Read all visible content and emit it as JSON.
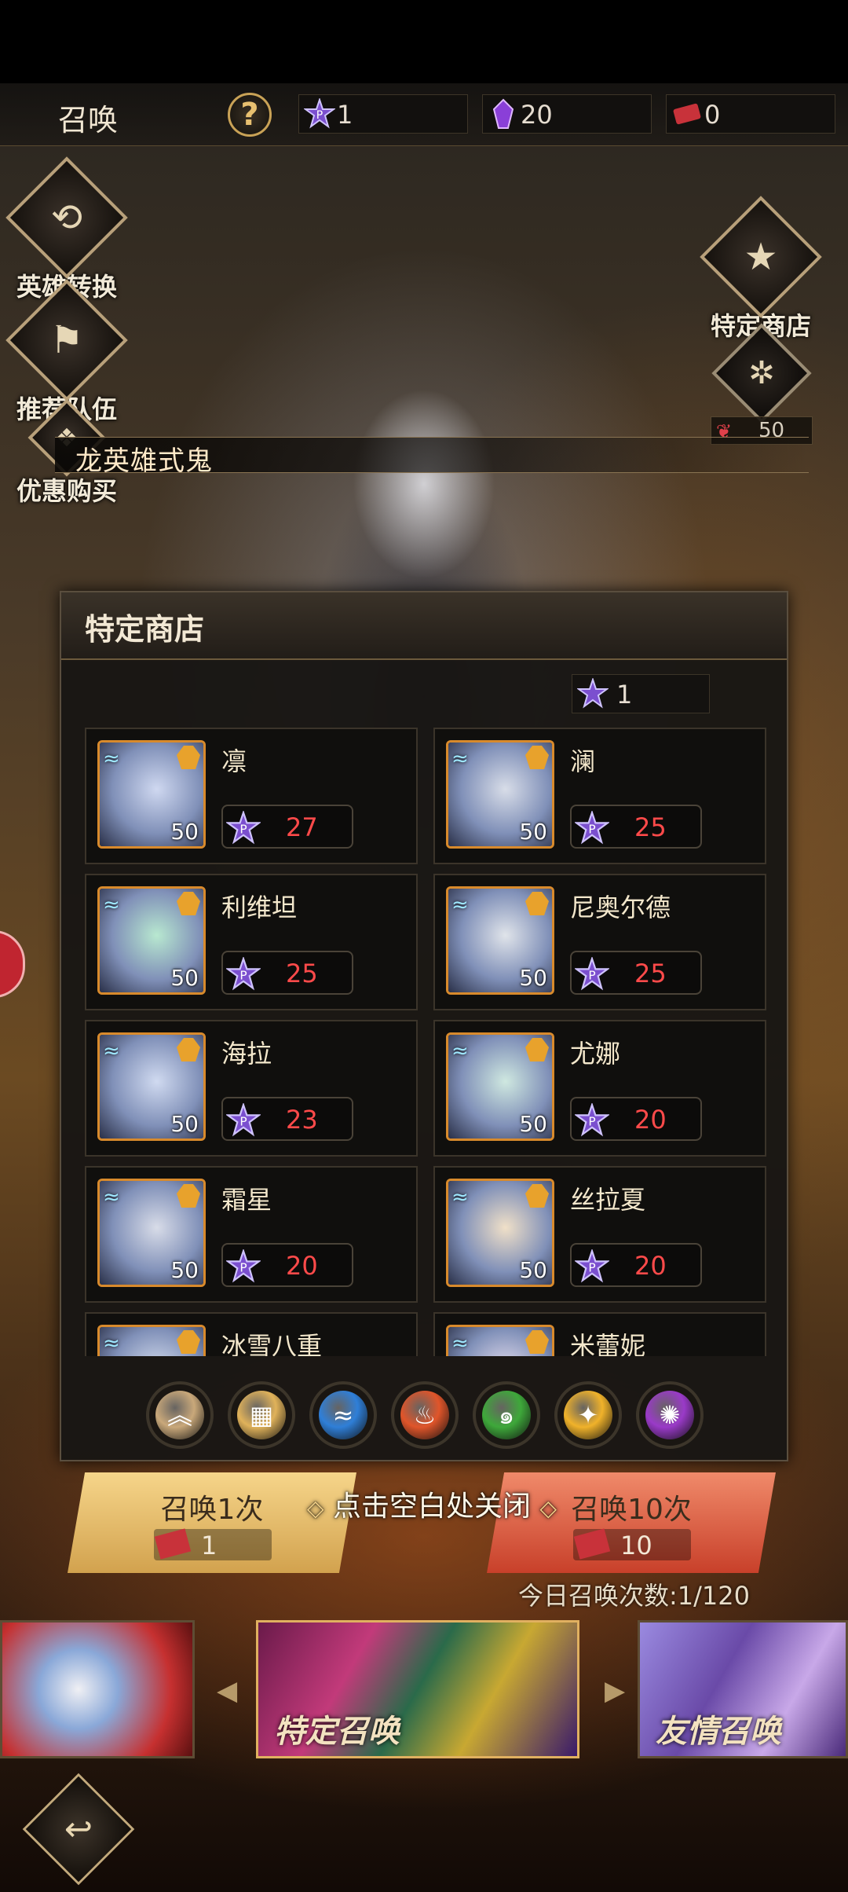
{
  "top_bar": {
    "title": "召唤",
    "help_label": "?",
    "resources": [
      {
        "icon": "purple-star-coin-icon",
        "value": "1"
      },
      {
        "icon": "purple-crystal-icon",
        "value": "20"
      },
      {
        "icon": "red-ticket-icon",
        "value": "0"
      }
    ]
  },
  "side_menu": {
    "hero_convert": "英雄转换",
    "recommend_team": "推荐队伍",
    "discount_buy": "优惠购买",
    "special_shop": "特定商店"
  },
  "card_ticket": {
    "cost": "50"
  },
  "hero_name_strip": "龙英雄式鬼",
  "shop": {
    "title": "特定商店",
    "balance": "1",
    "items": [
      {
        "name": "凛",
        "level": "50",
        "price": "27",
        "element": "water"
      },
      {
        "name": "澜",
        "level": "50",
        "price": "25",
        "element": "water"
      },
      {
        "name": "利维坦",
        "level": "50",
        "price": "25",
        "element": "water"
      },
      {
        "name": "尼奥尔德",
        "level": "50",
        "price": "25",
        "element": "water"
      },
      {
        "name": "海拉",
        "level": "50",
        "price": "23",
        "element": "water"
      },
      {
        "name": "尤娜",
        "level": "50",
        "price": "20",
        "element": "water"
      },
      {
        "name": "霜星",
        "level": "50",
        "price": "20",
        "element": "water"
      },
      {
        "name": "丝拉夏",
        "level": "50",
        "price": "20",
        "element": "water"
      },
      {
        "name": "冰雪八重",
        "level": "",
        "price": "",
        "element": "water"
      },
      {
        "name": "米蕾妮",
        "level": "",
        "price": "",
        "element": "water"
      }
    ],
    "filters": [
      {
        "name": "all-filter",
        "color": "#c9a87a",
        "glyph": "︽"
      },
      {
        "name": "grid-filter",
        "color": "#e0b25a",
        "glyph": "▦"
      },
      {
        "name": "water-filter",
        "color": "#2f7fd8",
        "glyph": "≈"
      },
      {
        "name": "fire-filter",
        "color": "#e0552a",
        "glyph": "♨"
      },
      {
        "name": "wind-filter",
        "color": "#3ea83a",
        "glyph": "๑"
      },
      {
        "name": "light-filter",
        "color": "#f0b22a",
        "glyph": "✦"
      },
      {
        "name": "dark-filter",
        "color": "#9a3ac8",
        "glyph": "✺"
      }
    ]
  },
  "summon": {
    "one_label": "召唤1次",
    "one_cost": "1",
    "ten_label": "召唤10次",
    "ten_cost": "10",
    "close_hint": "点击空白处关闭",
    "today_count": "今日召唤次数:1/120"
  },
  "carousel": {
    "banners": [
      "",
      "特定召唤",
      "友情召唤"
    ]
  },
  "colors": {
    "accent_gold": "#d88a2c",
    "price_red": "#ff4a4a",
    "panel_bg": "#181614"
  }
}
